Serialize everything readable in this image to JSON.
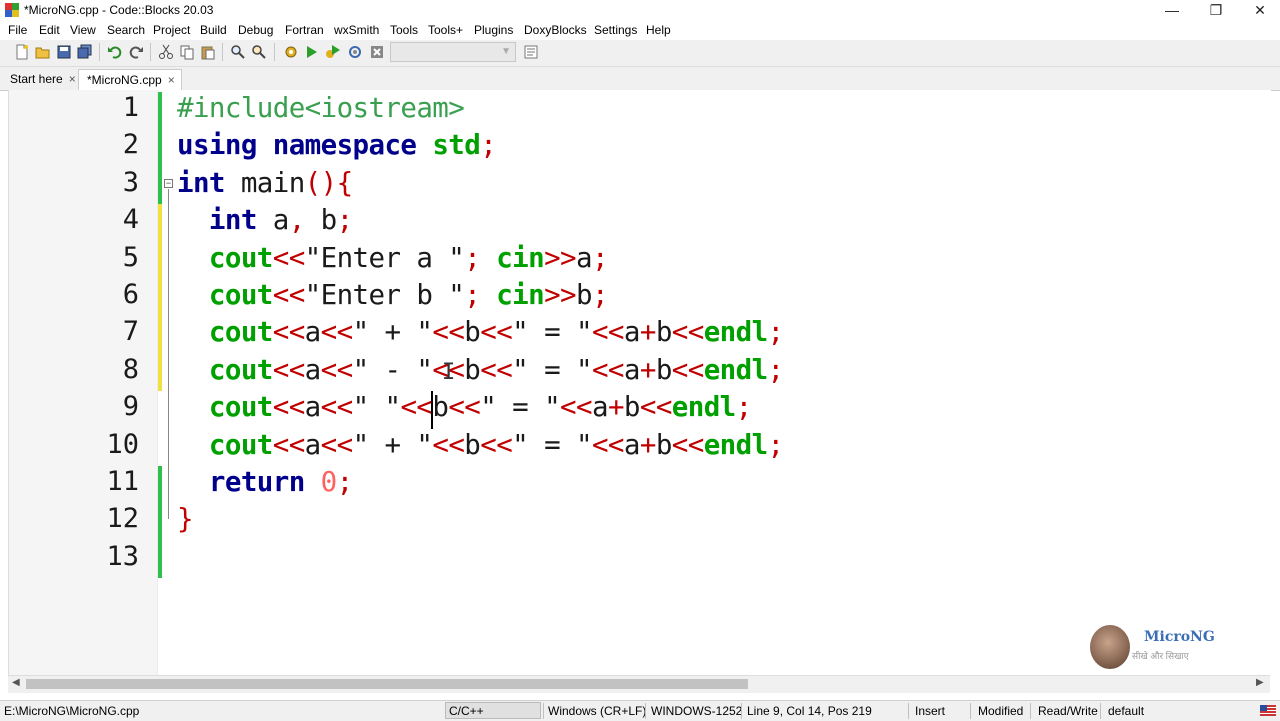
{
  "window": {
    "title": "*MicroNG.cpp - Code::Blocks 20.03",
    "minimize": "—",
    "restore": "❐",
    "close": "✕"
  },
  "menu": [
    "File",
    "Edit",
    "View",
    "Search",
    "Project",
    "Build",
    "Debug",
    "Fortran",
    "wxSmith",
    "Tools",
    "Tools+",
    "Plugins",
    "DoxyBlocks",
    "Settings",
    "Help"
  ],
  "tabs": [
    {
      "label": "Start here",
      "close": "×",
      "active": false
    },
    {
      "label": "*MicroNG.cpp",
      "close": "×",
      "active": true
    }
  ],
  "editor": {
    "line_numbers": [
      "1",
      "2",
      "3",
      "4",
      "5",
      "6",
      "7",
      "8",
      "9",
      "10",
      "11",
      "12",
      "13"
    ],
    "lines": [
      [
        [
          "pp",
          "#include<iostream>"
        ]
      ],
      [
        [
          "kw",
          "using"
        ],
        [
          "id",
          " "
        ],
        [
          "kw",
          "namespace"
        ],
        [
          "id",
          " "
        ],
        [
          "std",
          "std"
        ],
        [
          "op",
          ";"
        ]
      ],
      [
        [
          "kw",
          "int"
        ],
        [
          "id",
          " main"
        ],
        [
          "op",
          "(){"
        ]
      ],
      [
        [
          "id",
          "  "
        ],
        [
          "kw",
          "int"
        ],
        [
          "id",
          " a"
        ],
        [
          "op",
          ","
        ],
        [
          "id",
          " b"
        ],
        [
          "op",
          ";"
        ]
      ],
      [
        [
          "id",
          "  "
        ],
        [
          "std",
          "cout"
        ],
        [
          "op",
          "<<"
        ],
        [
          "str",
          "\"Enter a \""
        ],
        [
          "op",
          ";"
        ],
        [
          "id",
          " "
        ],
        [
          "std",
          "cin"
        ],
        [
          "op",
          ">>"
        ],
        [
          "id",
          "a"
        ],
        [
          "op",
          ";"
        ]
      ],
      [
        [
          "id",
          "  "
        ],
        [
          "std",
          "cout"
        ],
        [
          "op",
          "<<"
        ],
        [
          "str",
          "\"Enter b \""
        ],
        [
          "op",
          ";"
        ],
        [
          "id",
          " "
        ],
        [
          "std",
          "cin"
        ],
        [
          "op",
          ">>"
        ],
        [
          "id",
          "b"
        ],
        [
          "op",
          ";"
        ]
      ],
      [
        [
          "id",
          "  "
        ],
        [
          "std",
          "cout"
        ],
        [
          "op",
          "<<"
        ],
        [
          "id",
          "a"
        ],
        [
          "op",
          "<<"
        ],
        [
          "str",
          "\" + \""
        ],
        [
          "op",
          "<<"
        ],
        [
          "id",
          "b"
        ],
        [
          "op",
          "<<"
        ],
        [
          "str",
          "\" = \""
        ],
        [
          "op",
          "<<"
        ],
        [
          "id",
          "a"
        ],
        [
          "op",
          "+"
        ],
        [
          "id",
          "b"
        ],
        [
          "op",
          "<<"
        ],
        [
          "std",
          "endl"
        ],
        [
          "op",
          ";"
        ]
      ],
      [
        [
          "id",
          "  "
        ],
        [
          "std",
          "cout"
        ],
        [
          "op",
          "<<"
        ],
        [
          "id",
          "a"
        ],
        [
          "op",
          "<<"
        ],
        [
          "str",
          "\" - \""
        ],
        [
          "op",
          "<<"
        ],
        [
          "id",
          "b"
        ],
        [
          "op",
          "<<"
        ],
        [
          "str",
          "\" = \""
        ],
        [
          "op",
          "<<"
        ],
        [
          "id",
          "a"
        ],
        [
          "op",
          "+"
        ],
        [
          "id",
          "b"
        ],
        [
          "op",
          "<<"
        ],
        [
          "std",
          "endl"
        ],
        [
          "op",
          ";"
        ]
      ],
      [
        [
          "id",
          "  "
        ],
        [
          "std",
          "cout"
        ],
        [
          "op",
          "<<"
        ],
        [
          "id",
          "a"
        ],
        [
          "op",
          "<<"
        ],
        [
          "str",
          "\" \""
        ],
        [
          "op",
          "<<"
        ],
        [
          "id",
          "b"
        ],
        [
          "op",
          "<<"
        ],
        [
          "str",
          "\" = \""
        ],
        [
          "op",
          "<<"
        ],
        [
          "id",
          "a"
        ],
        [
          "op",
          "+"
        ],
        [
          "id",
          "b"
        ],
        [
          "op",
          "<<"
        ],
        [
          "std",
          "endl"
        ],
        [
          "op",
          ";"
        ]
      ],
      [
        [
          "id",
          "  "
        ],
        [
          "std",
          "cout"
        ],
        [
          "op",
          "<<"
        ],
        [
          "id",
          "a"
        ],
        [
          "op",
          "<<"
        ],
        [
          "str",
          "\" + \""
        ],
        [
          "op",
          "<<"
        ],
        [
          "id",
          "b"
        ],
        [
          "op",
          "<<"
        ],
        [
          "str",
          "\" = \""
        ],
        [
          "op",
          "<<"
        ],
        [
          "id",
          "a"
        ],
        [
          "op",
          "+"
        ],
        [
          "id",
          "b"
        ],
        [
          "op",
          "<<"
        ],
        [
          "std",
          "endl"
        ],
        [
          "op",
          ";"
        ]
      ],
      [
        [
          "id",
          "  "
        ],
        [
          "kw",
          "return"
        ],
        [
          "id",
          " "
        ],
        [
          "num",
          "0"
        ],
        [
          "op",
          ";"
        ]
      ],
      [
        [
          "op",
          "}"
        ]
      ],
      [
        [
          "id",
          ""
        ]
      ]
    ]
  },
  "watermark": {
    "name": "MicroNG",
    "tagline": "सीखे और सिखाए"
  },
  "status": {
    "path": "E:\\MicroNG\\MicroNG.cpp",
    "language": "C/C++",
    "line_endings": "Windows (CR+LF)",
    "encoding": "WINDOWS-1252",
    "position": "Line 9, Col 14, Pos 219",
    "mode": "Insert",
    "modified": "Modified",
    "access": "Read/Write",
    "profile": "default"
  },
  "colors": {
    "keyword": "#00008b",
    "stdlib": "#00a000",
    "operator": "#c00000",
    "preprocessor": "#3aa050",
    "number": "#ff6060"
  },
  "icons": [
    "new-file-icon",
    "open-icon",
    "save-icon",
    "save-all-icon",
    "undo-icon",
    "redo-icon",
    "cut-icon",
    "copy-icon",
    "paste-icon",
    "find-icon",
    "replace-icon",
    "build-icon",
    "run-icon",
    "build-run-icon",
    "rebuild-icon",
    "abort-icon",
    "target-combo",
    "jump-icon"
  ]
}
